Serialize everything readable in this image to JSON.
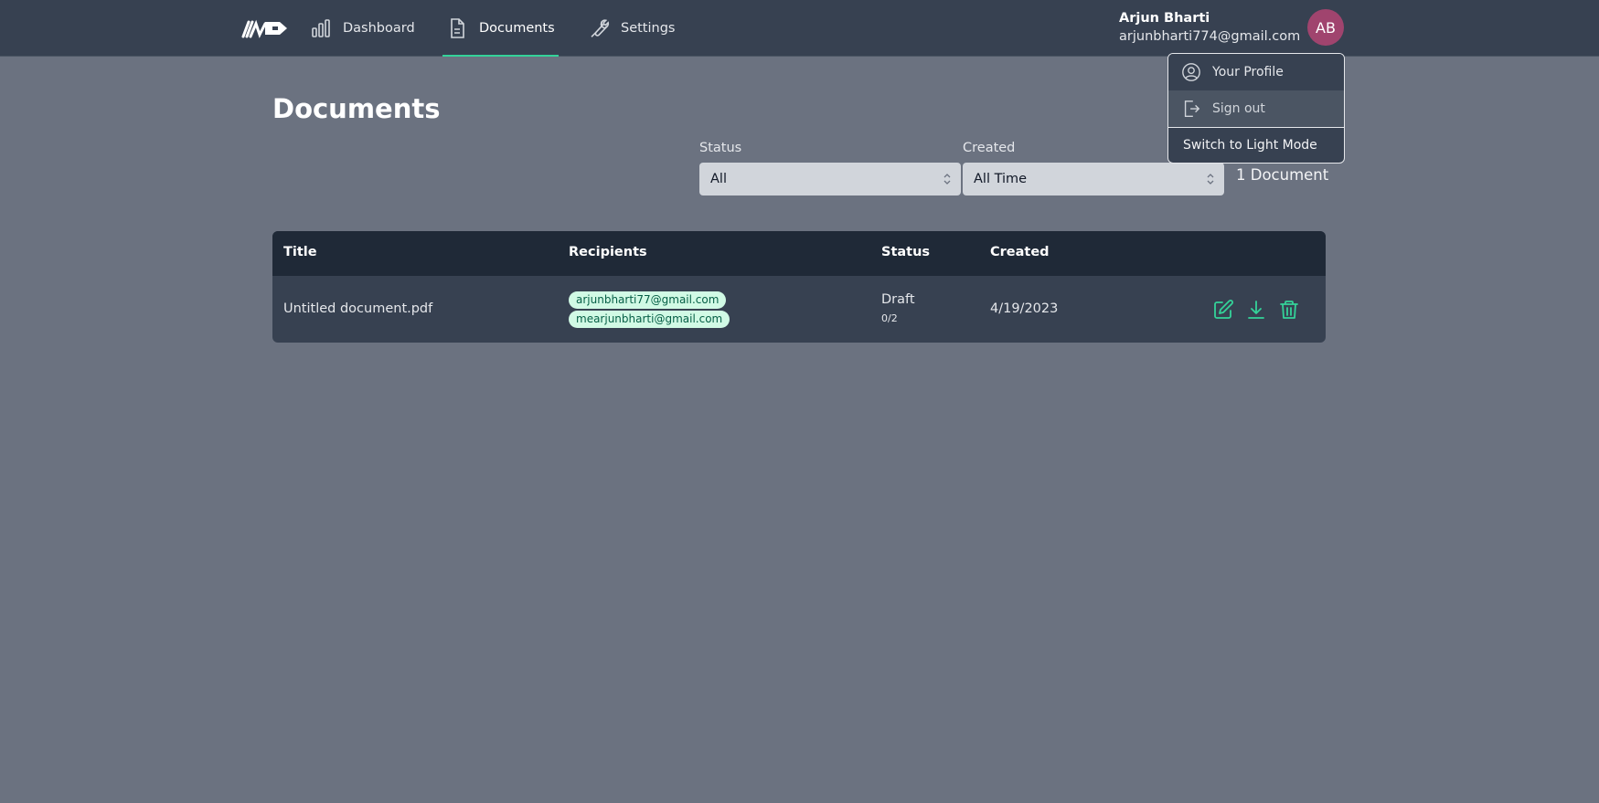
{
  "nav": {
    "items": [
      {
        "label": "Dashboard",
        "icon": "bar-chart-icon"
      },
      {
        "label": "Documents",
        "icon": "document-icon"
      },
      {
        "label": "Settings",
        "icon": "wrench-icon"
      }
    ],
    "active": "Documents"
  },
  "user": {
    "name": "Arjun Bharti",
    "email": "arjunbharti774@gmail.com",
    "initials": "AB"
  },
  "menu": {
    "profile": "Your Profile",
    "signout": "Sign out",
    "switch": "Switch to Light Mode"
  },
  "page": {
    "title": "Documents",
    "doc_count": "1 Document"
  },
  "filters": {
    "status_label": "Status",
    "status_value": "All",
    "created_label": "Created",
    "created_value": "All Time"
  },
  "table": {
    "headers": {
      "title": "Title",
      "recipients": "Recipients",
      "status": "Status",
      "created": "Created"
    },
    "rows": [
      {
        "title": "Untitled document.pdf",
        "recipients": [
          "arjunbharti77@gmail.com",
          "mearjunbharti@gmail.com"
        ],
        "status": "Draft",
        "status_sub": "0/2",
        "created": "4/19/2023"
      }
    ]
  },
  "colors": {
    "accent": "#34d399",
    "topbar": "#374151",
    "background": "#6b7280",
    "avatar": "#a0446e",
    "chip_bg": "#d1fae5"
  }
}
